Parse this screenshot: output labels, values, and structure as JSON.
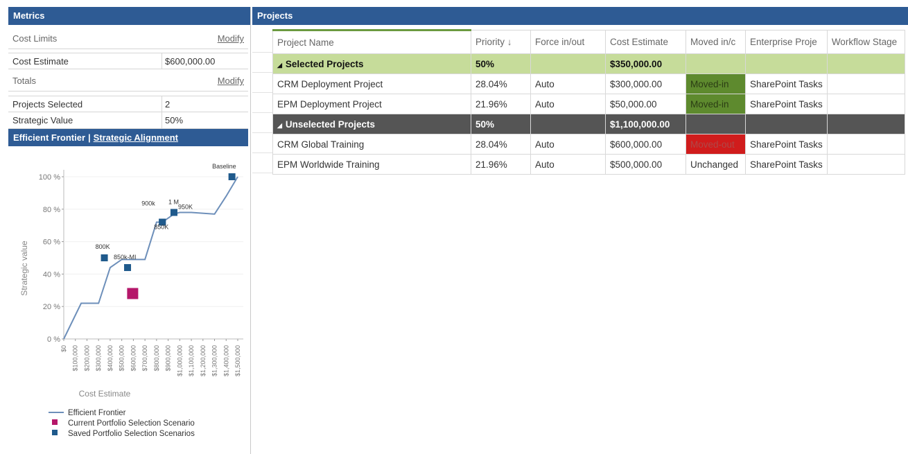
{
  "metrics": {
    "header": "Metrics",
    "cost_limits_label": "Cost Limits",
    "modify_label": "Modify",
    "cost_estimate_label": "Cost Estimate",
    "cost_estimate_value": "$600,000.00",
    "totals_label": "Totals",
    "totals_modify_label": "Modify",
    "projects_selected_label": "Projects Selected",
    "projects_selected_value": "2",
    "strategic_value_label": "Strategic Value",
    "strategic_value_value": "50%",
    "tab_efficient_frontier": "Efficient Frontier",
    "tab_separator": "|",
    "tab_strategic_alignment": "Strategic Alignment"
  },
  "chart_data": {
    "type": "line",
    "title": "",
    "xlabel": "Cost Estimate",
    "ylabel": "Strategic value",
    "x_ticks": [
      "$0",
      "$100,000",
      "$200,000",
      "$300,000",
      "$400,000",
      "$500,000",
      "$600,000",
      "$700,000",
      "$800,000",
      "$900,000",
      "$1,000,000",
      "$1,100,000",
      "$1,200,000",
      "$1,300,000",
      "$1,400,000",
      "$1,500,000"
    ],
    "y_ticks": [
      "0 %",
      "20 %",
      "40 %",
      "60 %",
      "80 %",
      "100 %"
    ],
    "xlim": [
      0,
      1500000
    ],
    "ylim": [
      0,
      100
    ],
    "series": [
      {
        "name": "Efficient Frontier",
        "color": "#6d8fba",
        "x": [
          0,
          150000,
          250000,
          300000,
          400000,
          500000,
          550000,
          700000,
          800000,
          850000,
          950000,
          1000000,
          1100000,
          1300000,
          1400000,
          1500000
        ],
        "y": [
          0,
          22,
          22,
          22,
          44,
          49,
          49,
          49,
          72,
          72,
          77,
          78,
          78,
          77,
          88,
          100
        ]
      }
    ],
    "current_scenario": {
      "name": "Current Portfolio Selection Scenario",
      "color": "#b5176a",
      "x": [
        600000
      ],
      "y": [
        28
      ]
    },
    "saved_scenarios": {
      "name": "Saved Portfolio Selection Scenarios",
      "color": "#1f5a8c",
      "points": [
        {
          "label": "800K",
          "x": 350000,
          "y": 50
        },
        {
          "label": "850k-MI",
          "x": 550000,
          "y": 44
        },
        {
          "label": "900k",
          "x": 850000,
          "y": 72
        },
        {
          "label": "850K",
          "x": 850000,
          "y": 72
        },
        {
          "label": "1 M",
          "x": 950000,
          "y": 78
        },
        {
          "label": "950K",
          "x": 950000,
          "y": 78
        },
        {
          "label": "Baseline",
          "x": 1450000,
          "y": 100
        }
      ]
    },
    "legend": [
      "Efficient Frontier",
      "Current Portfolio Selection Scenario",
      "Saved Portfolio Selection Scenarios"
    ],
    "legend_position": "bottom-left",
    "grid": false
  },
  "projects": {
    "header": "Projects",
    "columns": [
      "Project Name",
      "Priority ↓",
      "Force in/out",
      "Cost Estimate",
      "Moved in/c",
      "Enterprise Proje",
      "Workflow Stage"
    ],
    "groups": [
      {
        "name": "Selected Projects",
        "priority": "50%",
        "cost": "$350,000.00",
        "rows": [
          {
            "name": "CRM Deployment Project",
            "priority": "28.04%",
            "force": "Auto",
            "cost": "$300,000.00",
            "moved": "Moved-in",
            "moved_state": "in",
            "enterprise": "SharePoint Tasks",
            "workflow": ""
          },
          {
            "name": "EPM Deployment Project",
            "priority": "21.96%",
            "force": "Auto",
            "cost": "$50,000.00",
            "moved": "Moved-in",
            "moved_state": "in",
            "enterprise": "SharePoint Tasks",
            "workflow": ""
          }
        ]
      },
      {
        "name": "Unselected Projects",
        "priority": "50%",
        "cost": "$1,100,000.00",
        "rows": [
          {
            "name": "CRM Global Training",
            "priority": "28.04%",
            "force": "Auto",
            "cost": "$600,000.00",
            "moved": "Moved-out",
            "moved_state": "out",
            "enterprise": "SharePoint Tasks",
            "workflow": ""
          },
          {
            "name": "EPM Worldwide Training",
            "priority": "21.96%",
            "force": "Auto",
            "cost": "$500,000.00",
            "moved": "Unchanged",
            "moved_state": "none",
            "enterprise": "SharePoint Tasks",
            "workflow": ""
          }
        ]
      }
    ]
  }
}
